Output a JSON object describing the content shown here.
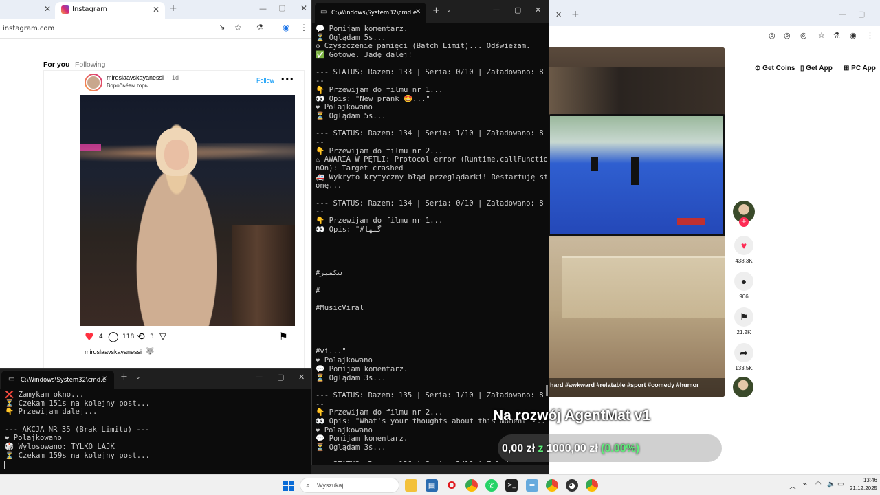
{
  "browser": {
    "tab_title": "Instagram",
    "url": "instagram.com",
    "feed_tabs": [
      "For you",
      "Following"
    ],
    "post": {
      "username": "miroslaavskayanessi",
      "time": "1d",
      "location": "Воробьёвы горы",
      "follow_label": "Follow",
      "likes": "4",
      "comments": "118",
      "reposts": "3",
      "caption_user": "miroslaavskayanessi"
    }
  },
  "cmd_main": {
    "title": "C:\\Windows\\System32\\cmd.e",
    "lines": [
      "💬 Pomijam komentarz.",
      "⏳ Oglądam 5s...",
      "♻ Czyszczenie pamięci (Batch Limit)... Odświeżam.",
      "✅ Gotowe. Jadę dalej!",
      "",
      "--- STATUS: Razem: 133 | Seria: 0/10 | Załadowano: 8 -",
      "--",
      "👇 Przewijam do filmu nr 1...",
      "👀 Opis: \"New prank 🤩...\"",
      "❤ Polajkowano",
      "⏳ Oglądam 5s...",
      "",
      "--- STATUS: Razem: 134 | Seria: 1/10 | Załadowano: 8 -",
      "--",
      "👇 Przewijam do filmu nr 2...",
      "⚠ AWARIA W PĘTLI: Protocol error (Runtime.callFunctio",
      "nOn): Target crashed",
      "🚑 Wykryto krytyczny błąd przeglądarki! Restartuję str",
      "onę...",
      "",
      "--- STATUS: Razem: 134 | Seria: 0/10 | Załadowano: 8 -",
      "--",
      "👇 Przewijam do filmu nr 1...",
      "👀 Opis: \"#گنها",
      "",
      "",
      "",
      "",
      "#سکمیر",
      "",
      "#",
      "",
      "#MusicViral",
      "",
      "",
      "",
      "",
      "#vi...\"",
      "❤ Polajkowano",
      "💬 Pomijam komentarz.",
      "⏳ Oglądam 3s...",
      "",
      "--- STATUS: Razem: 135 | Seria: 1/10 | Załadowano: 8 -",
      "--",
      "👇 Przewijam do filmu nr 2...",
      "👀 Opis: \"What's your thoughts about this moment ⚬...\"",
      "❤ Polajkowano",
      "💬 Pomijam komentarz.",
      "⏳ Oglądam 3s...",
      "",
      "--- STATUS: Razem: 136 | Seria: 2/10 | Załadow",
      "--"
    ]
  },
  "cmd_small": {
    "title": "C:\\Windows\\System32\\cmd.e",
    "lines": [
      "❌ Zamykam okno...",
      "⏳ Czekam 151s na kolejny post...",
      "👇 Przewijam dalej...",
      "",
      "--- AKCJA NR 35 (Brak Limitu) ---",
      "❤ Polajkowano",
      "🎲 Wylosowano: TYLKO LAJK",
      "⏳ Czekam 159s na kolejny post..."
    ]
  },
  "tiktok": {
    "header_buttons": [
      "Get Coins",
      "Get App",
      "PC App"
    ],
    "likes": "438.3K",
    "comments": "906",
    "saves": "21.2K",
    "shares": "133.5K",
    "hashtags": "hard #awkward #relatable #sport #comedy #humor"
  },
  "overlay": {
    "title": "Na rozwój AgentMat v1",
    "amount": "0,00 zł",
    "of": "z",
    "goal": "1000,00 zł",
    "percent": "(0.00%)",
    "progress_fraction": 0.0
  },
  "taskbar": {
    "search_placeholder": "Wyszukaj",
    "time": "13:46",
    "date": "21.12.2025"
  },
  "colors": {
    "accent_green": "#5ef07a",
    "heart": "#fe2c55",
    "cmd_bg": "#0c0c0c"
  }
}
